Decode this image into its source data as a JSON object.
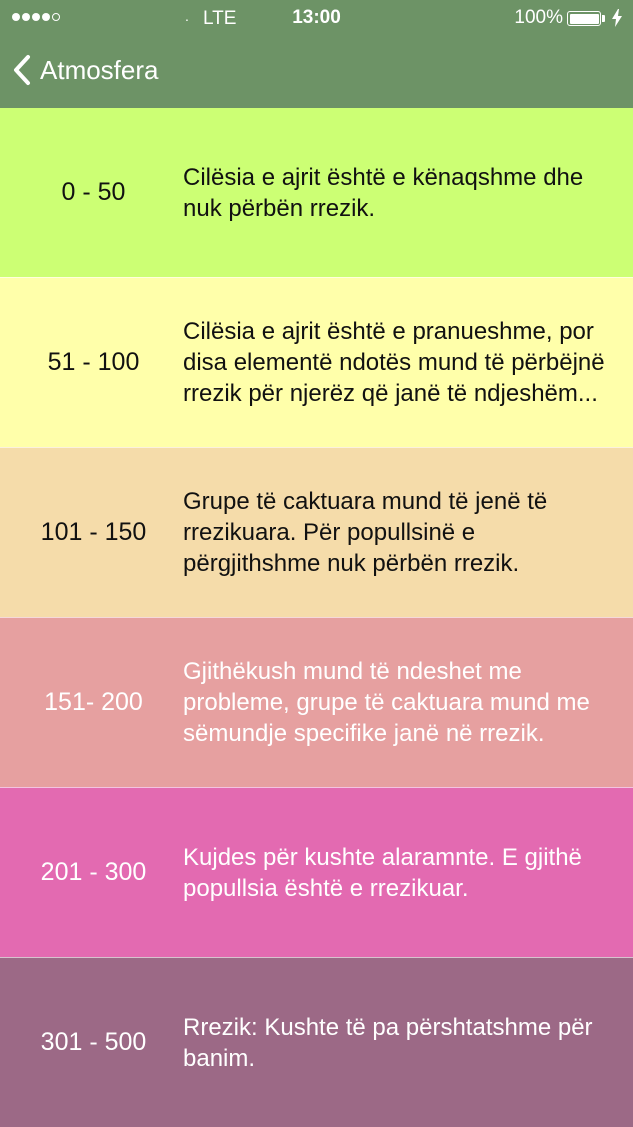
{
  "status_bar": {
    "carrier_dot": ".",
    "network": "LTE",
    "time": "13:00",
    "battery_percent": "100%",
    "battery_level": 1.0,
    "signal_strength": 4,
    "signal_max": 5,
    "icons": {
      "signal": "signal-dots-icon",
      "battery": "battery-icon",
      "charging": "charging-bolt-icon"
    }
  },
  "nav": {
    "back_label": "Atmosfera",
    "back_icon": "chevron-left-icon"
  },
  "colors": {
    "header": "#6d9366",
    "text_dark": "#111111",
    "text_light": "#ffffff"
  },
  "rows": [
    {
      "range": "0 - 50",
      "description": "Cilësia e ajrit është e kënaqshme dhe nuk përbën rrezik.",
      "color": "#ccff74",
      "text_color": "#111111"
    },
    {
      "range": "51 - 100",
      "description": "Cilësia e ajrit është e pranueshme, por disa elementë ndotës mund të përbëjnë rrezik për njerëz që janë të ndjeshëm...",
      "color": "#ffffaa",
      "text_color": "#111111"
    },
    {
      "range": "101 - 150",
      "description": "Grupe të caktuara mund të jenë të rrezikuara. Për popullsinë e përgjithshme nuk përbën rrezik.",
      "color": "#f5dcaa",
      "text_color": "#111111"
    },
    {
      "range": "151- 200",
      "description": "Gjithëkush mund të ndeshet me probleme, grupe të caktuara mund me sëmundje specifike janë në rrezik.",
      "color": "#e6a0a0",
      "text_color": "#ffffff"
    },
    {
      "range": "201 - 300",
      "description": "Kujdes për kushte alaramnte. E gjithë popullsia është e rrezikuar.",
      "color": "#e36ab1",
      "text_color": "#ffffff"
    },
    {
      "range": "301 - 500",
      "description": "Rrezik: Kushte të pa përshtatshme për banim.",
      "color": "#9c6986",
      "text_color": "#ffffff"
    }
  ]
}
